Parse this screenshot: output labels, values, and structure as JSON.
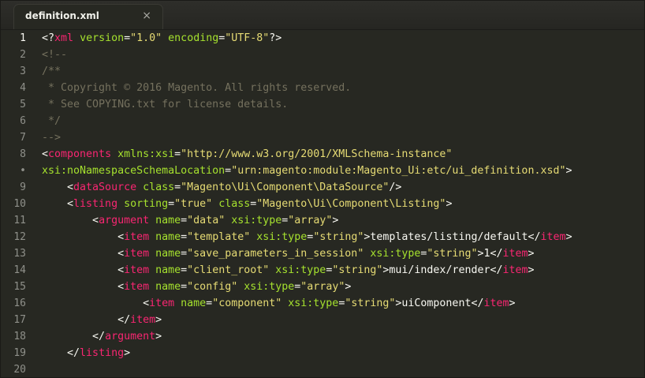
{
  "tab": {
    "title": "definition.xml",
    "close": "×"
  },
  "colors": {
    "background": "#272822",
    "tag": "#f92672",
    "attribute": "#a6e22e",
    "string": "#e6db74",
    "comment": "#75715e",
    "text": "#f8f8f2",
    "line_number": "#8f908a"
  },
  "editor": {
    "current_line": "1",
    "lines": [
      {
        "num": "1",
        "tokens": [
          {
            "t": "<?",
            "c": "bracket"
          },
          {
            "t": "xml",
            "c": "tag"
          },
          {
            "t": " ",
            "c": "text"
          },
          {
            "t": "version",
            "c": "attr"
          },
          {
            "t": "=",
            "c": "text"
          },
          {
            "t": "\"1.0\"",
            "c": "string"
          },
          {
            "t": " ",
            "c": "text"
          },
          {
            "t": "encoding",
            "c": "attr"
          },
          {
            "t": "=",
            "c": "text"
          },
          {
            "t": "\"UTF-8\"",
            "c": "string"
          },
          {
            "t": "?>",
            "c": "bracket"
          }
        ]
      },
      {
        "num": "2",
        "tokens": [
          {
            "t": "<!--",
            "c": "comment"
          }
        ]
      },
      {
        "num": "3",
        "tokens": [
          {
            "t": "/**",
            "c": "comment"
          }
        ]
      },
      {
        "num": "4",
        "tokens": [
          {
            "t": " * Copyright © 2016 Magento. All rights reserved.",
            "c": "comment"
          }
        ]
      },
      {
        "num": "5",
        "tokens": [
          {
            "t": " * See COPYING.txt for license details.",
            "c": "comment"
          }
        ]
      },
      {
        "num": "6",
        "tokens": [
          {
            "t": " */",
            "c": "comment"
          }
        ]
      },
      {
        "num": "7",
        "tokens": [
          {
            "t": "-->",
            "c": "comment"
          }
        ]
      },
      {
        "num": "8",
        "tokens": [
          {
            "t": "<",
            "c": "bracket"
          },
          {
            "t": "components",
            "c": "tag"
          },
          {
            "t": " ",
            "c": "text"
          },
          {
            "t": "xmlns:xsi",
            "c": "attr"
          },
          {
            "t": "=",
            "c": "text"
          },
          {
            "t": "\"http://www.w3.org/2001/XMLSchema-instance\"",
            "c": "string"
          }
        ]
      },
      {
        "num": "•",
        "tokens": [
          {
            "t": "xsi:noNamespaceSchemaLocation",
            "c": "attr"
          },
          {
            "t": "=",
            "c": "text"
          },
          {
            "t": "\"urn:magento:module:Magento_Ui:etc/ui_definition.xsd\"",
            "c": "string"
          },
          {
            "t": ">",
            "c": "bracket"
          }
        ]
      },
      {
        "num": "9",
        "tokens": [
          {
            "t": "    <",
            "c": "bracket"
          },
          {
            "t": "dataSource",
            "c": "tag"
          },
          {
            "t": " ",
            "c": "text"
          },
          {
            "t": "class",
            "c": "attr"
          },
          {
            "t": "=",
            "c": "text"
          },
          {
            "t": "\"Magento\\Ui\\Component\\DataSource\"",
            "c": "string"
          },
          {
            "t": "/>",
            "c": "bracket"
          }
        ]
      },
      {
        "num": "10",
        "tokens": [
          {
            "t": "    <",
            "c": "bracket"
          },
          {
            "t": "listing",
            "c": "tag"
          },
          {
            "t": " ",
            "c": "text"
          },
          {
            "t": "sorting",
            "c": "attr"
          },
          {
            "t": "=",
            "c": "text"
          },
          {
            "t": "\"true\"",
            "c": "string"
          },
          {
            "t": " ",
            "c": "text"
          },
          {
            "t": "class",
            "c": "attr"
          },
          {
            "t": "=",
            "c": "text"
          },
          {
            "t": "\"Magento\\Ui\\Component\\Listing\"",
            "c": "string"
          },
          {
            "t": ">",
            "c": "bracket"
          }
        ]
      },
      {
        "num": "11",
        "tokens": [
          {
            "t": "        <",
            "c": "bracket"
          },
          {
            "t": "argument",
            "c": "tag"
          },
          {
            "t": " ",
            "c": "text"
          },
          {
            "t": "name",
            "c": "attr"
          },
          {
            "t": "=",
            "c": "text"
          },
          {
            "t": "\"data\"",
            "c": "string"
          },
          {
            "t": " ",
            "c": "text"
          },
          {
            "t": "xsi:type",
            "c": "attr"
          },
          {
            "t": "=",
            "c": "text"
          },
          {
            "t": "\"array\"",
            "c": "string"
          },
          {
            "t": ">",
            "c": "bracket"
          }
        ]
      },
      {
        "num": "12",
        "tokens": [
          {
            "t": "            <",
            "c": "bracket"
          },
          {
            "t": "item",
            "c": "tag"
          },
          {
            "t": " ",
            "c": "text"
          },
          {
            "t": "name",
            "c": "attr"
          },
          {
            "t": "=",
            "c": "text"
          },
          {
            "t": "\"template\"",
            "c": "string"
          },
          {
            "t": " ",
            "c": "text"
          },
          {
            "t": "xsi:type",
            "c": "attr"
          },
          {
            "t": "=",
            "c": "text"
          },
          {
            "t": "\"string\"",
            "c": "string"
          },
          {
            "t": ">",
            "c": "bracket"
          },
          {
            "t": "templates/listing/default",
            "c": "text"
          },
          {
            "t": "</",
            "c": "bracket"
          },
          {
            "t": "item",
            "c": "tag"
          },
          {
            "t": ">",
            "c": "bracket"
          }
        ]
      },
      {
        "num": "13",
        "tokens": [
          {
            "t": "            <",
            "c": "bracket"
          },
          {
            "t": "item",
            "c": "tag"
          },
          {
            "t": " ",
            "c": "text"
          },
          {
            "t": "name",
            "c": "attr"
          },
          {
            "t": "=",
            "c": "text"
          },
          {
            "t": "\"save_parameters_in_session\"",
            "c": "string"
          },
          {
            "t": " ",
            "c": "text"
          },
          {
            "t": "xsi:type",
            "c": "attr"
          },
          {
            "t": "=",
            "c": "text"
          },
          {
            "t": "\"string\"",
            "c": "string"
          },
          {
            "t": ">",
            "c": "bracket"
          },
          {
            "t": "1",
            "c": "text"
          },
          {
            "t": "</",
            "c": "bracket"
          },
          {
            "t": "item",
            "c": "tag"
          },
          {
            "t": ">",
            "c": "bracket"
          }
        ]
      },
      {
        "num": "14",
        "tokens": [
          {
            "t": "            <",
            "c": "bracket"
          },
          {
            "t": "item",
            "c": "tag"
          },
          {
            "t": " ",
            "c": "text"
          },
          {
            "t": "name",
            "c": "attr"
          },
          {
            "t": "=",
            "c": "text"
          },
          {
            "t": "\"client_root\"",
            "c": "string"
          },
          {
            "t": " ",
            "c": "text"
          },
          {
            "t": "xsi:type",
            "c": "attr"
          },
          {
            "t": "=",
            "c": "text"
          },
          {
            "t": "\"string\"",
            "c": "string"
          },
          {
            "t": ">",
            "c": "bracket"
          },
          {
            "t": "mui/index/render",
            "c": "text"
          },
          {
            "t": "</",
            "c": "bracket"
          },
          {
            "t": "item",
            "c": "tag"
          },
          {
            "t": ">",
            "c": "bracket"
          }
        ]
      },
      {
        "num": "15",
        "tokens": [
          {
            "t": "            <",
            "c": "bracket"
          },
          {
            "t": "item",
            "c": "tag"
          },
          {
            "t": " ",
            "c": "text"
          },
          {
            "t": "name",
            "c": "attr"
          },
          {
            "t": "=",
            "c": "text"
          },
          {
            "t": "\"config\"",
            "c": "string"
          },
          {
            "t": " ",
            "c": "text"
          },
          {
            "t": "xsi:type",
            "c": "attr"
          },
          {
            "t": "=",
            "c": "text"
          },
          {
            "t": "\"array\"",
            "c": "string"
          },
          {
            "t": ">",
            "c": "bracket"
          }
        ]
      },
      {
        "num": "16",
        "tokens": [
          {
            "t": "                <",
            "c": "bracket"
          },
          {
            "t": "item",
            "c": "tag"
          },
          {
            "t": " ",
            "c": "text"
          },
          {
            "t": "name",
            "c": "attr"
          },
          {
            "t": "=",
            "c": "text"
          },
          {
            "t": "\"component\"",
            "c": "string"
          },
          {
            "t": " ",
            "c": "text"
          },
          {
            "t": "xsi:type",
            "c": "attr"
          },
          {
            "t": "=",
            "c": "text"
          },
          {
            "t": "\"string\"",
            "c": "string"
          },
          {
            "t": ">",
            "c": "bracket"
          },
          {
            "t": "uiComponent",
            "c": "text"
          },
          {
            "t": "</",
            "c": "bracket"
          },
          {
            "t": "item",
            "c": "tag"
          },
          {
            "t": ">",
            "c": "bracket"
          }
        ]
      },
      {
        "num": "17",
        "tokens": [
          {
            "t": "            </",
            "c": "bracket"
          },
          {
            "t": "item",
            "c": "tag"
          },
          {
            "t": ">",
            "c": "bracket"
          }
        ]
      },
      {
        "num": "18",
        "tokens": [
          {
            "t": "        </",
            "c": "bracket"
          },
          {
            "t": "argument",
            "c": "tag"
          },
          {
            "t": ">",
            "c": "bracket"
          }
        ]
      },
      {
        "num": "19",
        "tokens": [
          {
            "t": "    </",
            "c": "bracket"
          },
          {
            "t": "listing",
            "c": "tag"
          },
          {
            "t": ">",
            "c": "bracket"
          }
        ]
      },
      {
        "num": "20",
        "tokens": []
      }
    ]
  }
}
